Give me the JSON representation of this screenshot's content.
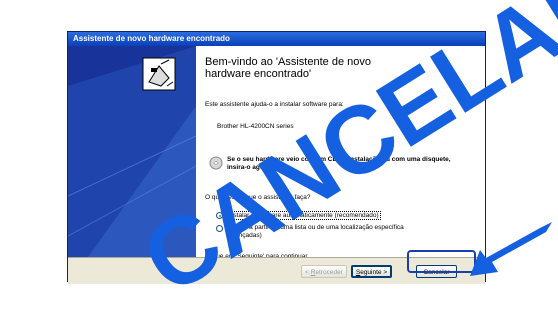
{
  "window": {
    "title": "Assistente de novo hardware encontrado"
  },
  "content": {
    "heading": "Bem-vindo ao 'Assistente de novo hardware encontrado'",
    "intro": "Este assistente ajuda-o a instalar software para:",
    "device": "Brother HL-4200CN series",
    "cd_hint": "Se o seu hardware veio com um CD de instalação ou com uma disquete, insira-o agora.",
    "question": "O que deseja que o assistente faça?",
    "option_auto": "Instalar o software automaticamente (recomendado)",
    "option_manual": "Instalar a partir de uma lista ou de uma localização específica (avançadas)",
    "continue_hint": "Clique em 'Seguinte' para continuar."
  },
  "buttons": {
    "back_prefix": "< ",
    "back_letter": "R",
    "back_rest": "etroceder",
    "next_letter": "S",
    "next_rest": "eguinte >",
    "cancel": "Cancelar"
  },
  "overlay": {
    "text": "CANCELAR",
    "color": "#1560e0"
  },
  "icons": [
    "hardware-wizard-icon",
    "cd-icon",
    "arrow-icon"
  ]
}
